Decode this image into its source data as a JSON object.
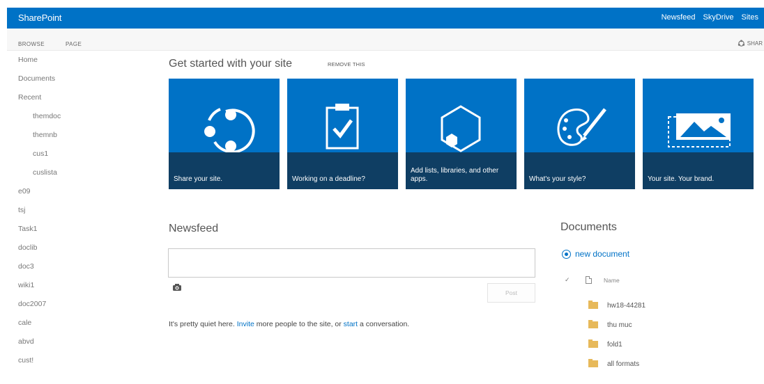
{
  "suite_bar": {
    "brand": "SharePoint",
    "links": [
      "Newsfeed",
      "SkyDrive",
      "Sites"
    ]
  },
  "ribbon": {
    "tabs": [
      "BROWSE",
      "PAGE"
    ],
    "share_label": "SHAR"
  },
  "left_nav": {
    "items": [
      {
        "label": "Home",
        "level": 0
      },
      {
        "label": "Documents",
        "level": 0
      },
      {
        "label": "Recent",
        "level": 0
      },
      {
        "label": "themdoc",
        "level": 1
      },
      {
        "label": "themnb",
        "level": 1
      },
      {
        "label": "cus1",
        "level": 1
      },
      {
        "label": "cuslista",
        "level": 1
      },
      {
        "label": "e09",
        "level": 0
      },
      {
        "label": "tsj",
        "level": 0
      },
      {
        "label": "Task1",
        "level": 0
      },
      {
        "label": "doclib",
        "level": 0
      },
      {
        "label": "doc3",
        "level": 0
      },
      {
        "label": "wiki1",
        "level": 0
      },
      {
        "label": "doc2007",
        "level": 0
      },
      {
        "label": "cale",
        "level": 0
      },
      {
        "label": "abvd",
        "level": 0
      },
      {
        "label": "cust!",
        "level": 0
      }
    ]
  },
  "get_started": {
    "title": "Get started with your site",
    "remove_label": "REMOVE THIS",
    "tiles": [
      {
        "icon": "share-icon",
        "caption": "Share your site."
      },
      {
        "icon": "clipboard-check-icon",
        "caption": "Working on a deadline?"
      },
      {
        "icon": "hexagon-apps-icon",
        "caption": "Add lists, libraries, and other apps."
      },
      {
        "icon": "palette-brush-icon",
        "caption": "What's your style?"
      },
      {
        "icon": "picture-frame-icon",
        "caption": "Your site. Your brand."
      }
    ]
  },
  "newsfeed": {
    "title": "Newsfeed",
    "input_value": "",
    "post_label": "Post",
    "quiet_before": "It's pretty quiet here. ",
    "invite_link": "Invite",
    "quiet_middle": " more people to the site, or ",
    "start_link": "start",
    "quiet_after": " a conversation."
  },
  "documents": {
    "title": "Documents",
    "new_label": "new document",
    "name_header": "Name",
    "files": [
      "hw18-44281",
      "thu muc",
      "fold1",
      "all formats"
    ]
  },
  "colors": {
    "suite_bar": "#0072c6",
    "tile": "#0072c6",
    "tile_caption": "#0f3e63",
    "link": "#0072c6",
    "folder": "#e7b95a"
  }
}
